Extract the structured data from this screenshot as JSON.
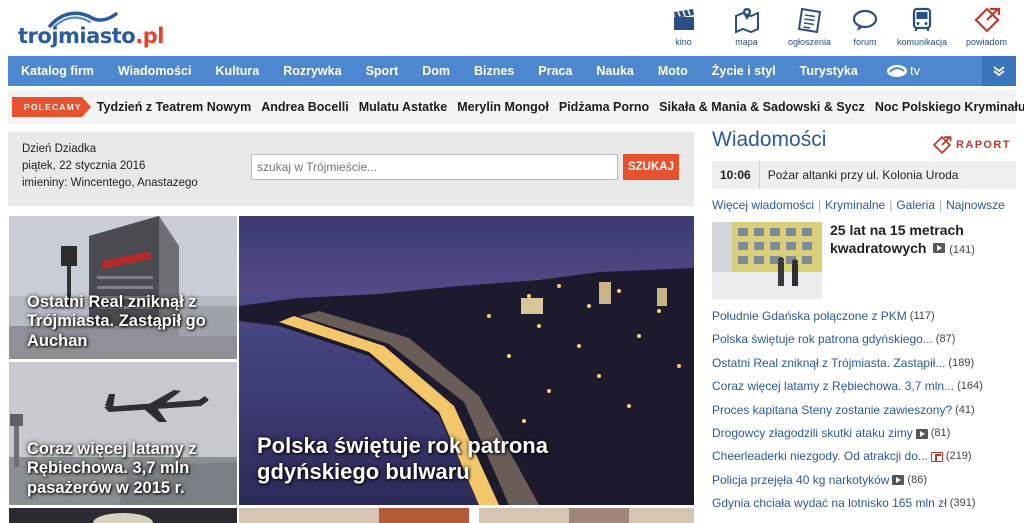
{
  "logo": {
    "main": "trojmiasto",
    "suffix": ".pl"
  },
  "services": [
    {
      "label": "kino",
      "icon": "clapperboard-icon"
    },
    {
      "label": "mapa",
      "icon": "map-icon"
    },
    {
      "label": "ogłoszenia",
      "icon": "newspaper-icon"
    },
    {
      "label": "forum",
      "icon": "chat-icon"
    },
    {
      "label": "komunikacja",
      "icon": "bus-icon"
    },
    {
      "label": "powiadom",
      "icon": "report-icon"
    }
  ],
  "nav": {
    "items": [
      "Katalog firm",
      "Wiadomości",
      "Kultura",
      "Rozrywka",
      "Sport",
      "Dom",
      "Biznes",
      "Praca",
      "Nauka",
      "Moto",
      "Życie i styl",
      "Turystyka"
    ],
    "tv_label": "tv"
  },
  "polecamy": {
    "tag": "POLECAMY",
    "links": [
      "Tydzień z Teatrem Nowym",
      "Andrea Bocelli",
      "Mulatu Astatke",
      "Merylin Mongoł",
      "Pidżama Porno",
      "Sikała & Mania & Sadowski & Sycz",
      "Noc Polskiego Kryminału"
    ]
  },
  "info": {
    "dayname": "Dzień Dziadka",
    "date_prefix": "piątek,",
    "date": "22 stycznia 2016",
    "imieniny_prefix": "imieniny:",
    "imieniny": "Wincentego, Anastazego"
  },
  "search": {
    "placeholder": "szukaj w Trójmieście...",
    "button": "SZUKAJ"
  },
  "tiles": [
    {
      "caption": "Ostatni Real zniknął z Trójmiasta. Zastąpił go Auchan"
    },
    {
      "caption": "Coraz więcej latamy z Rębiechowa. 3,7 mln pasażerów w 2015 r."
    },
    {
      "caption": "Polska świętuje rok patrona gdyńskiego bulwaru"
    }
  ],
  "sidebar": {
    "title": "Wiadomości",
    "raport": "RAPORT",
    "breaking": {
      "time": "10:06",
      "text": "Pożar altanki przy ul. Kolonia Uroda"
    },
    "links": [
      "Więcej wiadomości",
      "Kryminalne",
      "Galeria",
      "Najnowsze"
    ],
    "feature": {
      "title": "25 lat na 15 metrach kwadratowych",
      "count": "(141)"
    },
    "news": [
      {
        "text": "Południe Gdańska połączone z PKM",
        "count": "(117)",
        "icon": ""
      },
      {
        "text": "Polska świętuje rok patrona gdyńskiego...",
        "count": "(87)",
        "icon": ""
      },
      {
        "text": "Ostatni Real zniknął z Trójmiasta. Zastąpił...",
        "count": "(189)",
        "icon": ""
      },
      {
        "text": "Coraz więcej latamy z Rębiechowa. 3,7 mln...",
        "count": "(164)",
        "icon": ""
      },
      {
        "text": "Proces kapitana Steny zostanie zawieszony?",
        "count": "(41)",
        "icon": ""
      },
      {
        "text": "Drogowcy złagodzili skutki ataku zimy",
        "count": "(81)",
        "icon": "video"
      },
      {
        "text": "Cheerleaderki niezgody. Od atrakcji do...",
        "count": "(219)",
        "icon": "gallery"
      },
      {
        "text": "Policja przejęła 40 kg narkotyków",
        "count": "(86)",
        "icon": "video"
      },
      {
        "text": "Gdynia chciała wydać na lotnisko 165 mln zł",
        "count": "(391)",
        "icon": ""
      }
    ]
  },
  "colors": {
    "brand_blue": "#2a5aa0",
    "nav_blue": "#4d87cf",
    "accent_orange": "#e8512d"
  }
}
